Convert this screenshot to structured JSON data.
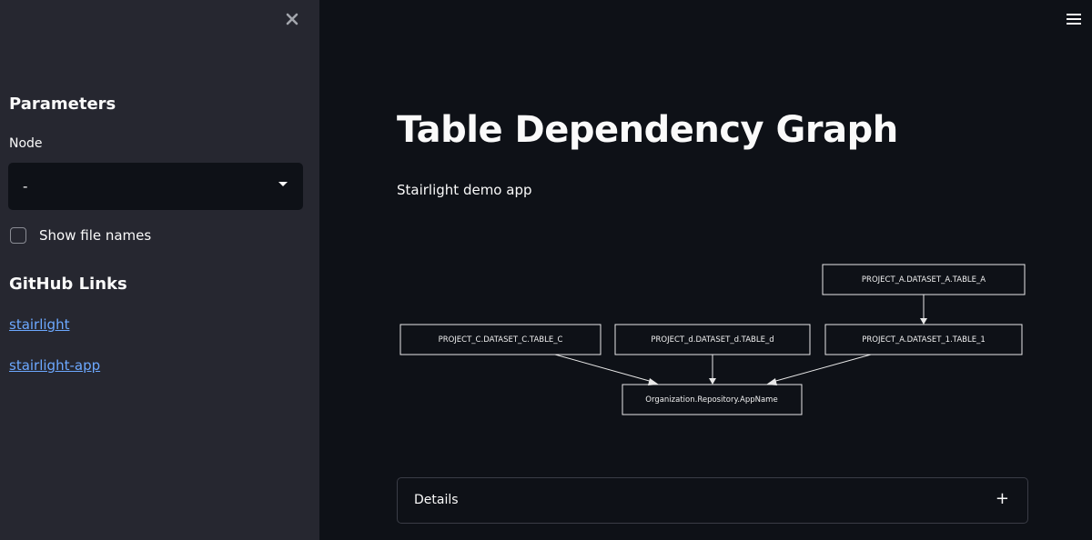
{
  "sidebar": {
    "close_icon": "close-icon",
    "parameters_heading": "Parameters",
    "node_label": "Node",
    "node_select_value": "-",
    "show_file_names_label": "Show file names",
    "show_file_names_checked": false,
    "github_heading": "GitHub Links",
    "links": [
      "stairlight",
      "stairlight-app"
    ]
  },
  "header": {
    "menu_icon": "hamburger-icon"
  },
  "main": {
    "title": "Table Dependency Graph",
    "subtitle": "Stairlight demo app",
    "details_label": "Details",
    "details_icon": "plus-icon"
  },
  "graph": {
    "nodes": {
      "project_a_table_a": "PROJECT_A.DATASET_A.TABLE_A",
      "project_c_table_c": "PROJECT_C.DATASET_C.TABLE_C",
      "project_d_table_d": "PROJECT_d.DATASET_d.TABLE_d",
      "project_a_table_1": "PROJECT_A.DATASET_1.TABLE_1",
      "app_name": "Organization.Repository.AppName"
    },
    "edges": [
      [
        "project_a_table_a",
        "project_a_table_1"
      ],
      [
        "project_c_table_c",
        "app_name"
      ],
      [
        "project_d_table_d",
        "app_name"
      ],
      [
        "project_a_table_1",
        "app_name"
      ]
    ]
  },
  "colors": {
    "main_bg": "#0e1117",
    "sidebar_bg": "#262730",
    "link": "#6ca8ff",
    "text": "#fafafa"
  }
}
